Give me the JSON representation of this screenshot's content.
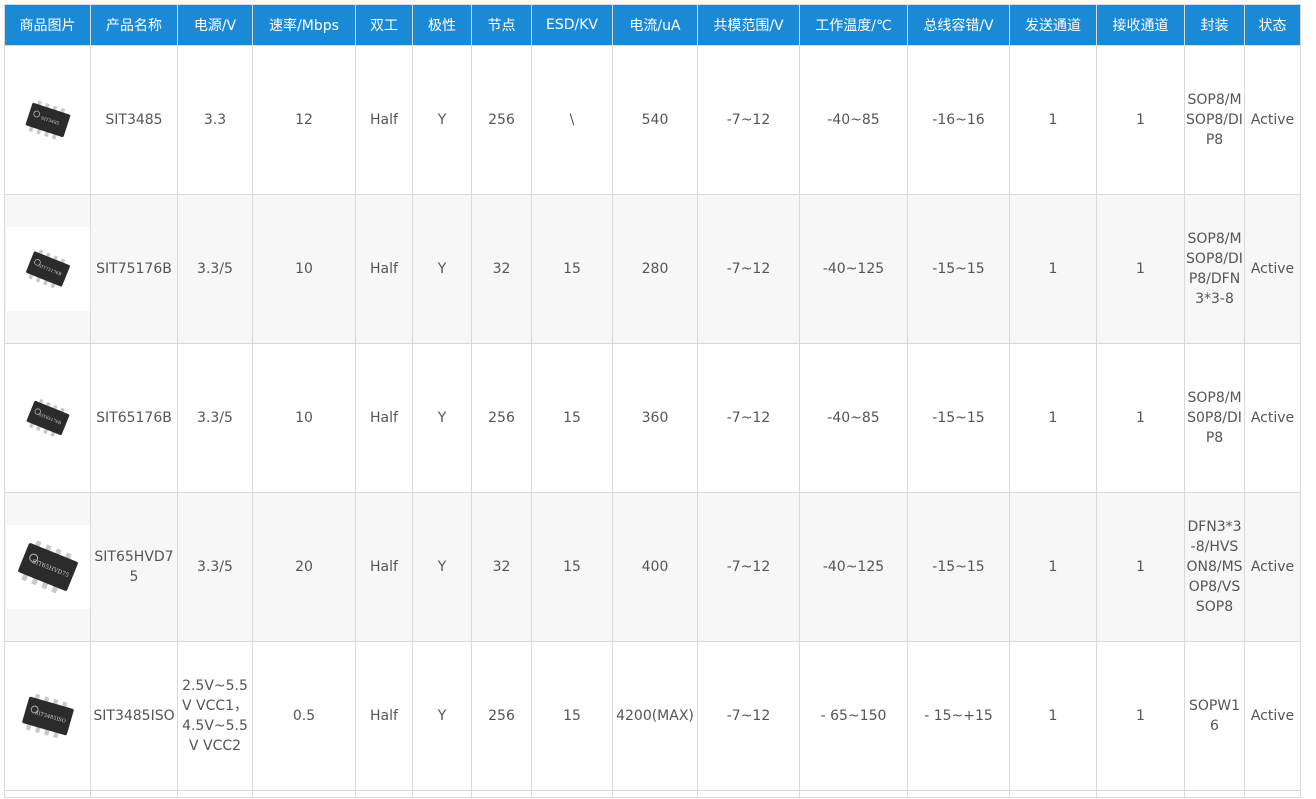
{
  "table": {
    "headers": [
      "商品图片",
      "产品名称",
      "电源/V",
      "速率/Mbps",
      "双工",
      "极性",
      "节点",
      "ESD/KV",
      "电流/uA",
      "共模范围/V",
      "工作温度/℃",
      "总线容错/V",
      "发送通道",
      "接收通道",
      "封装",
      "状态"
    ],
    "rows": [
      {
        "image_icon": "ic-chip-icon",
        "chip_marking": "SIT3485",
        "cells": [
          "SIT3485",
          "3.3",
          "12",
          "Half",
          "Y",
          "256",
          "\\",
          "540",
          "-7~12",
          "-40~85",
          "-16~16",
          "1",
          "1",
          "SOP8/MSOP8/DIP8",
          "Active"
        ]
      },
      {
        "image_icon": "ic-chip-icon",
        "chip_marking": "SIT75176B",
        "cells": [
          "SIT75176B",
          "3.3/5",
          "10",
          "Half",
          "Y",
          "32",
          "15",
          "280",
          "-7~12",
          "-40~125",
          "-15~15",
          "1",
          "1",
          "SOP8/MSOP8/DIP8/DFN3*3-8",
          "Active"
        ]
      },
      {
        "image_icon": "ic-chip-icon",
        "chip_marking": "SIT65176B",
        "cells": [
          "SIT65176B",
          "3.3/5",
          "10",
          "Half",
          "Y",
          "256",
          "15",
          "360",
          "-7~12",
          "-40~85",
          "-15~15",
          "1",
          "1",
          "SOP8/MS0P8/DIP8",
          "Active"
        ]
      },
      {
        "image_icon": "ic-chip-icon",
        "chip_marking": "SIT65HVD75",
        "cells": [
          "SIT65HVD75",
          "3.3/5",
          "20",
          "Half",
          "Y",
          "32",
          "15",
          "400",
          "-7~12",
          "-40~125",
          "-15~15",
          "1",
          "1",
          "DFN3*3-8/HVSON8/MSOP8/VSSOP8",
          "Active"
        ]
      },
      {
        "image_icon": "ic-chip-icon",
        "chip_marking": "SIT3485ISO",
        "cells": [
          "SIT3485ISO",
          "2.5V~5.5V VCC1，4.5V~5.5V VCC2",
          "0.5",
          "Half",
          "Y",
          "256",
          "15",
          "4200(MAX)",
          "-7~12",
          "- 65~150",
          "- 15~+15",
          "1",
          "1",
          "SOPW16",
          "Active"
        ]
      }
    ]
  },
  "colors": {
    "header_bg": "#1b8ad6",
    "header_text": "#ffffff",
    "border": "#d9d9d9",
    "body_text": "#555555",
    "alt_row_bg": "#f7f7f7",
    "chip_body": "#2b2b2b",
    "chip_pins": "#c9c9c9"
  }
}
